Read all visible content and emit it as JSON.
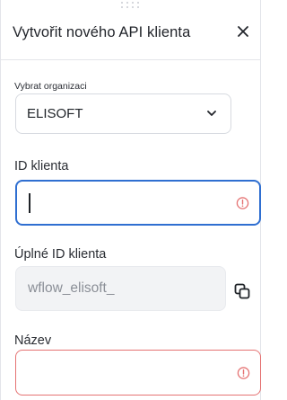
{
  "dialog": {
    "title": "Vytvořit nového API klienta",
    "close_icon": "close-icon"
  },
  "organization": {
    "label": "Vybrat organizaci",
    "selected": "ELISOFT"
  },
  "client_id": {
    "label": "ID klienta",
    "value": ""
  },
  "full_client_id": {
    "label": "Úplné ID klienta",
    "value": "wflow_elisoft_"
  },
  "name": {
    "label": "Název",
    "value": ""
  },
  "colors": {
    "focus_border": "#2f6fd1",
    "error": "#e57373"
  }
}
